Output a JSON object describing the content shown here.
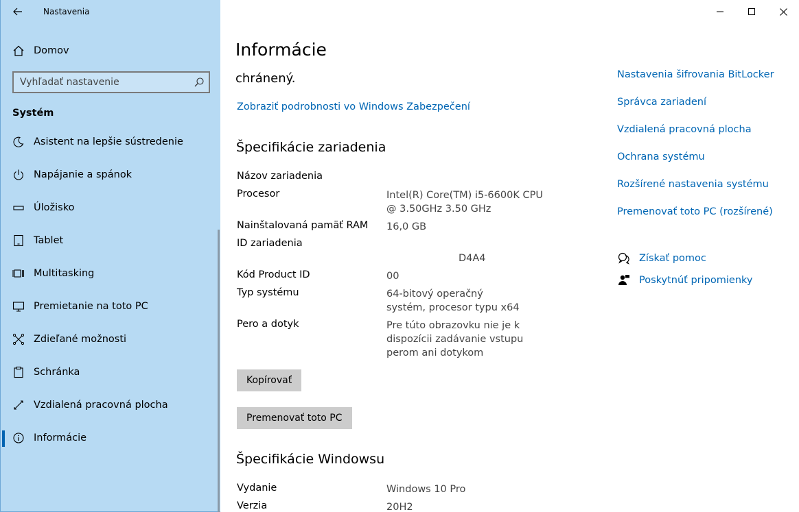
{
  "window": {
    "app_title": "Nastavenia"
  },
  "sidebar": {
    "home_label": "Domov",
    "search_placeholder": "Vyhľadať nastavenie",
    "section": "Systém",
    "items": [
      {
        "label": "Asistent na lepšie sústredenie",
        "icon": "moon-icon"
      },
      {
        "label": "Napájanie a spánok",
        "icon": "power-icon"
      },
      {
        "label": "Úložisko",
        "icon": "storage-icon"
      },
      {
        "label": "Tablet",
        "icon": "tablet-icon"
      },
      {
        "label": "Multitasking",
        "icon": "multitasking-icon"
      },
      {
        "label": "Premietanie na toto PC",
        "icon": "projecting-icon"
      },
      {
        "label": "Zdieľané možnosti",
        "icon": "shared-experiences-icon"
      },
      {
        "label": "Schránka",
        "icon": "clipboard-icon"
      },
      {
        "label": "Vzdialená pracovná plocha",
        "icon": "remote-desktop-icon"
      },
      {
        "label": "Informácie",
        "icon": "info-icon",
        "active": true
      }
    ]
  },
  "main": {
    "title": "Informácie",
    "clipped_line": "chránený.",
    "security_link": "Zobraziť podrobnosti vo Windows Zabezpečení",
    "device_specs": {
      "heading": "Špecifikácie zariadenia",
      "rows": [
        {
          "label": "Názov zariadenia",
          "value": ""
        },
        {
          "label": "Procesor",
          "value": "Intel(R) Core(TM) i5-6600K CPU @ 3.50GHz   3.50 GHz"
        },
        {
          "label": "Nainštalovaná pamäť RAM",
          "value": "16,0 GB"
        },
        {
          "label": "ID zariadenia",
          "value": "D4A4"
        },
        {
          "label": "Kód Product ID",
          "value": "00"
        },
        {
          "label": "Typ systému",
          "value": "64-bitový operačný systém, procesor typu x64"
        },
        {
          "label": "Pero a dotyk",
          "value": "Pre túto obrazovku nie je k dispozícii zadávanie vstupu perom ani dotykom"
        }
      ],
      "copy_button": "Kopírovať",
      "rename_button": "Premenovať toto PC"
    },
    "windows_specs": {
      "heading": "Špecifikácie Windowsu",
      "rows": [
        {
          "label": "Vydanie",
          "value": "Windows 10 Pro"
        },
        {
          "label": "Verzia",
          "value": "20H2"
        }
      ]
    }
  },
  "related": {
    "links": [
      "Nastavenia šifrovania BitLocker",
      "Správca zariadení",
      "Vzdialená pracovná plocha",
      "Ochrana systému",
      "Rozšírené nastavenia systému",
      "Premenovať toto PC (rozšírené)"
    ],
    "help": "Získať pomoc",
    "feedback": "Poskytnúť pripomienky"
  },
  "colors": {
    "sidebar_bg": "#b7daf3",
    "link": "#0066b4",
    "accent": "#0063b1",
    "button_bg": "#cccccc"
  }
}
